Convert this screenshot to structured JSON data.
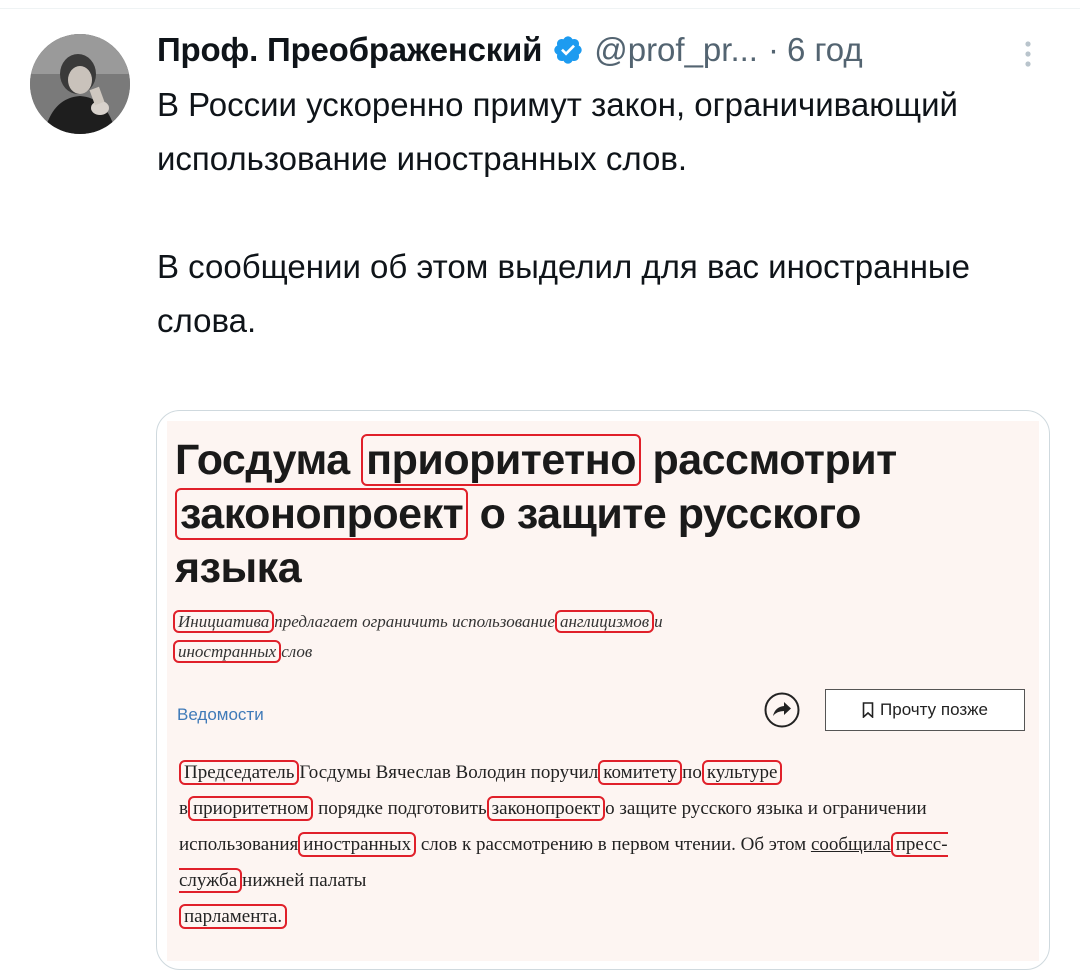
{
  "tweet": {
    "author_name": "Проф. Преображенский",
    "handle": "@prof_pr...",
    "time": "6 год",
    "text_para1": "В России ускоренно примут закон, ограничивающий использование иностранных слов.",
    "text_para2": "В сообщении об этом выделил для вас иностранные слова.",
    "icons": {
      "verified": "verified-badge-icon",
      "more": "more-vertical-icon"
    },
    "colors": {
      "verified": "#1d9bf0",
      "secondary_text": "#536471"
    }
  },
  "article": {
    "headline": {
      "w1": "Госдума",
      "w2": "приоритетно",
      "w3": "рассмотрит",
      "w4": "законопроект",
      "w5": "о защите русского",
      "w6": "языка"
    },
    "subtitle": {
      "w1": "Инициатива",
      "w2": "предлагает ограничить использование",
      "w3": "англицизмов",
      "w4": "и",
      "w5": "иностранных",
      "w6": "слов"
    },
    "source": "Ведомости",
    "read_later": "Прочту позже",
    "body": {
      "w1": "Председатель",
      "w2": "Госдумы Вячеслав Володин поручил",
      "w3": "комитету",
      "w4": "по",
      "w5": "культуре",
      "w6": "в",
      "w7": "приоритетном",
      "w8": "порядке подготовить",
      "w9": "законопроект",
      "w10": "о защите русского языка и ограничении использования",
      "w11": "иностранных",
      "w12": "слов к рассмотрению в первом чтении. Об этом",
      "w13": "сообщила",
      "w14": "пресс-служба",
      "w15": "нижней палаты",
      "w16": "парламента."
    },
    "colors": {
      "highlight_box": "#e0202a",
      "background": "#fdf5f2",
      "source_link": "#3f7ab8"
    },
    "icons": {
      "share": "share-arrow-icon",
      "bookmark": "bookmark-icon"
    }
  }
}
